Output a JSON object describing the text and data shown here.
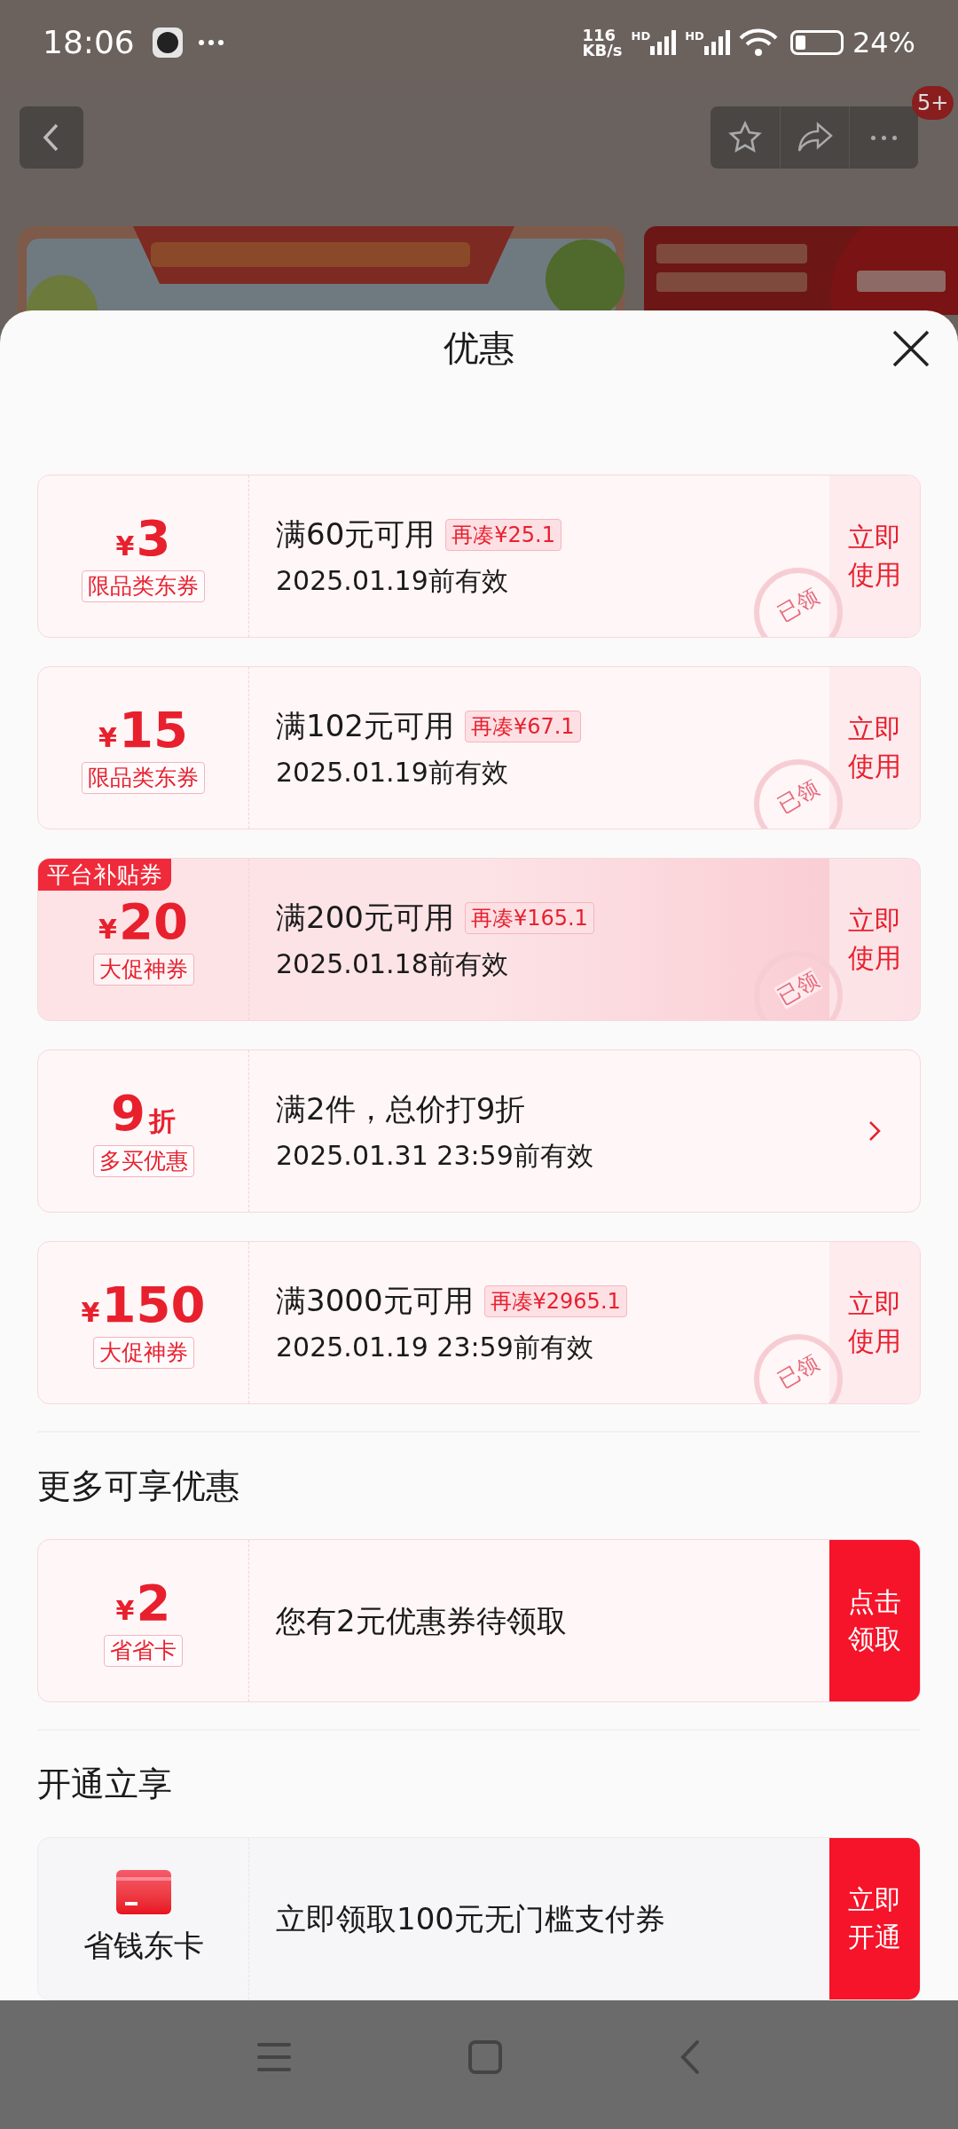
{
  "status_bar": {
    "time": "18:06",
    "speed_value": "116",
    "speed_unit": "KB/s",
    "signal_labels": [
      "HD",
      "HD"
    ],
    "battery": "24%"
  },
  "top_bar": {
    "badge": "5+"
  },
  "sheet": {
    "title": "优惠",
    "coupons": [
      {
        "kind": "coupon",
        "symbol": "¥",
        "amount": "3",
        "tag": "限品类东券",
        "condition": "满60元可用",
        "extra": "再凑¥25.1",
        "validity": "2025.01.19前有效",
        "action": "立即使用",
        "stamp": "已领",
        "featured": false
      },
      {
        "kind": "coupon",
        "symbol": "¥",
        "amount": "15",
        "tag": "限品类东券",
        "condition": "满102元可用",
        "extra": "再凑¥67.1",
        "validity": "2025.01.19前有效",
        "action": "立即使用",
        "stamp": "已领",
        "featured": false
      },
      {
        "kind": "coupon",
        "symbol": "¥",
        "amount": "20",
        "tag": "大促神券",
        "condition": "满200元可用",
        "extra": "再凑¥165.1",
        "validity": "2025.01.18前有效",
        "action": "立即使用",
        "stamp": "已领",
        "featured": true,
        "corner": "平台补贴券"
      },
      {
        "kind": "discount",
        "amount": "9",
        "unit": "折",
        "tag": "多买优惠",
        "condition": "满2件，总价打9折",
        "validity": "2025.01.31 23:59前有效",
        "featured": false
      },
      {
        "kind": "coupon",
        "symbol": "¥",
        "amount": "150",
        "tag": "大促神券",
        "condition": "满3000元可用",
        "extra": "再凑¥2965.1",
        "validity": "2025.01.19 23:59前有效",
        "action": "立即使用",
        "stamp": "已领",
        "featured": false
      }
    ],
    "more": {
      "heading": "更多可享优惠",
      "symbol": "¥",
      "amount": "2",
      "tag": "省省卡",
      "text": "您有2元优惠券待领取",
      "action": "点击领取"
    },
    "open": {
      "heading": "开通立享",
      "label": "省钱东卡",
      "text": "立即领取100元无门槛支付券",
      "action": "立即开通"
    }
  }
}
